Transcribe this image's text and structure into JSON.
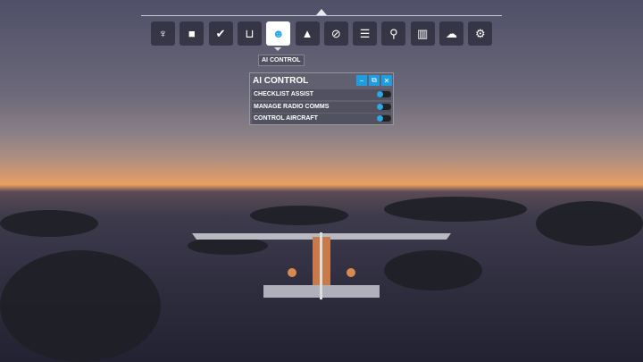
{
  "toolbar": {
    "items": [
      {
        "name": "atc-icon",
        "glyph": "♆"
      },
      {
        "name": "camera-icon",
        "glyph": "■"
      },
      {
        "name": "checklist-icon",
        "glyph": "✔"
      },
      {
        "name": "controls-icon",
        "glyph": "⊔"
      },
      {
        "name": "ai-control-icon",
        "glyph": "☻"
      },
      {
        "name": "weight-icon",
        "glyph": "▲"
      },
      {
        "name": "compass-icon",
        "glyph": "⊘"
      },
      {
        "name": "objectives-icon",
        "glyph": "☰"
      },
      {
        "name": "marker-icon",
        "glyph": "⚲"
      },
      {
        "name": "map-icon",
        "glyph": "▥"
      },
      {
        "name": "weather-icon",
        "glyph": "☁"
      },
      {
        "name": "settings-icon",
        "glyph": "⚙"
      }
    ],
    "tooltip": "AI CONTROL"
  },
  "panel": {
    "title": "AI CONTROL",
    "minimize": "−",
    "undock": "⧉",
    "close": "✕",
    "rows": [
      {
        "label": "CHECKLIST ASSIST",
        "on": false
      },
      {
        "label": "MANAGE RADIO COMMS",
        "on": false
      },
      {
        "label": "CONTROL AIRCRAFT",
        "on": false
      }
    ]
  }
}
